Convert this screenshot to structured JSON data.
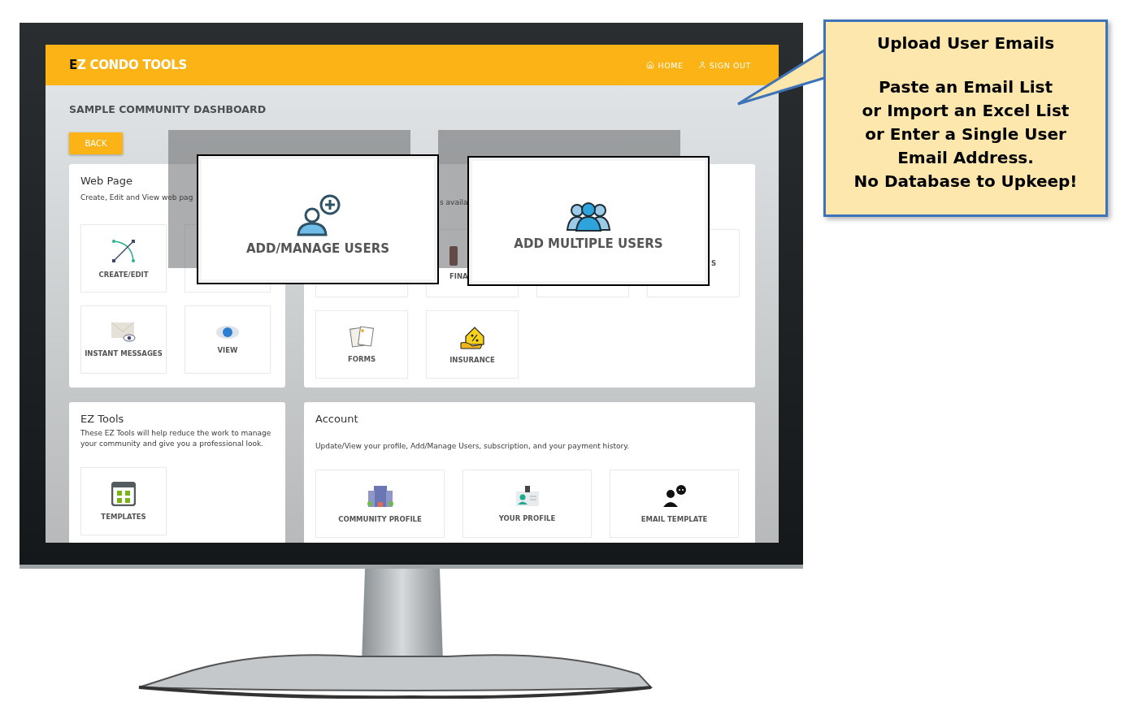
{
  "header": {
    "logo_initial": "E",
    "logo_rest": "Z CONDO TOOLS",
    "nav": [
      {
        "label": "HOME"
      },
      {
        "label": "SIGN OUT"
      }
    ]
  },
  "page_title": "SAMPLE COMMUNITY DASHBOARD",
  "back_button": "BACK",
  "cards": [
    {
      "title": "Web Page",
      "description": "Create, Edit and View web pag",
      "tiles": [
        {
          "kind": "full",
          "label": "CREATE/EDIT"
        },
        {
          "kind": "covered"
        },
        {
          "kind": "full",
          "label": "INSTANT MESSAGES"
        },
        {
          "kind": "full",
          "label": "VIEW"
        }
      ]
    },
    {
      "description": "s availa",
      "tiles": [
        {
          "kind": "covered"
        },
        {
          "kind": "cut-right",
          "label": "FINA"
        },
        {
          "kind": "covered"
        },
        {
          "kind": "cut-left",
          "label": "S"
        },
        {
          "kind": "full",
          "label": "FORMS"
        },
        {
          "kind": "full",
          "label": "INSURANCE"
        }
      ]
    },
    {
      "title": "EZ Tools",
      "description": "These EZ Tools will help reduce the work to manage your community and give you a professional look.",
      "tiles": [
        {
          "kind": "full",
          "label": "TEMPLATES"
        }
      ]
    },
    {
      "title": "Account",
      "description": "Update/View your profile, Add/Manage Users, subscription, and your payment history.",
      "tiles": [
        {
          "kind": "full",
          "label": "COMMUNITY PROFILE"
        },
        {
          "kind": "full",
          "label": "YOUR PROFILE"
        },
        {
          "kind": "full",
          "label": "EMAIL TEMPLATE"
        }
      ]
    }
  ],
  "overlays": [
    {
      "label": "ADD/MANAGE USERS"
    },
    {
      "label": "ADD MULTIPLE USERS"
    }
  ],
  "callout": {
    "title": "Upload User Emails",
    "lines": [
      "Paste an Email List",
      "or Import an Excel List",
      "or Enter a Single User",
      "Email Address.",
      "No Database to Upkeep!"
    ]
  }
}
